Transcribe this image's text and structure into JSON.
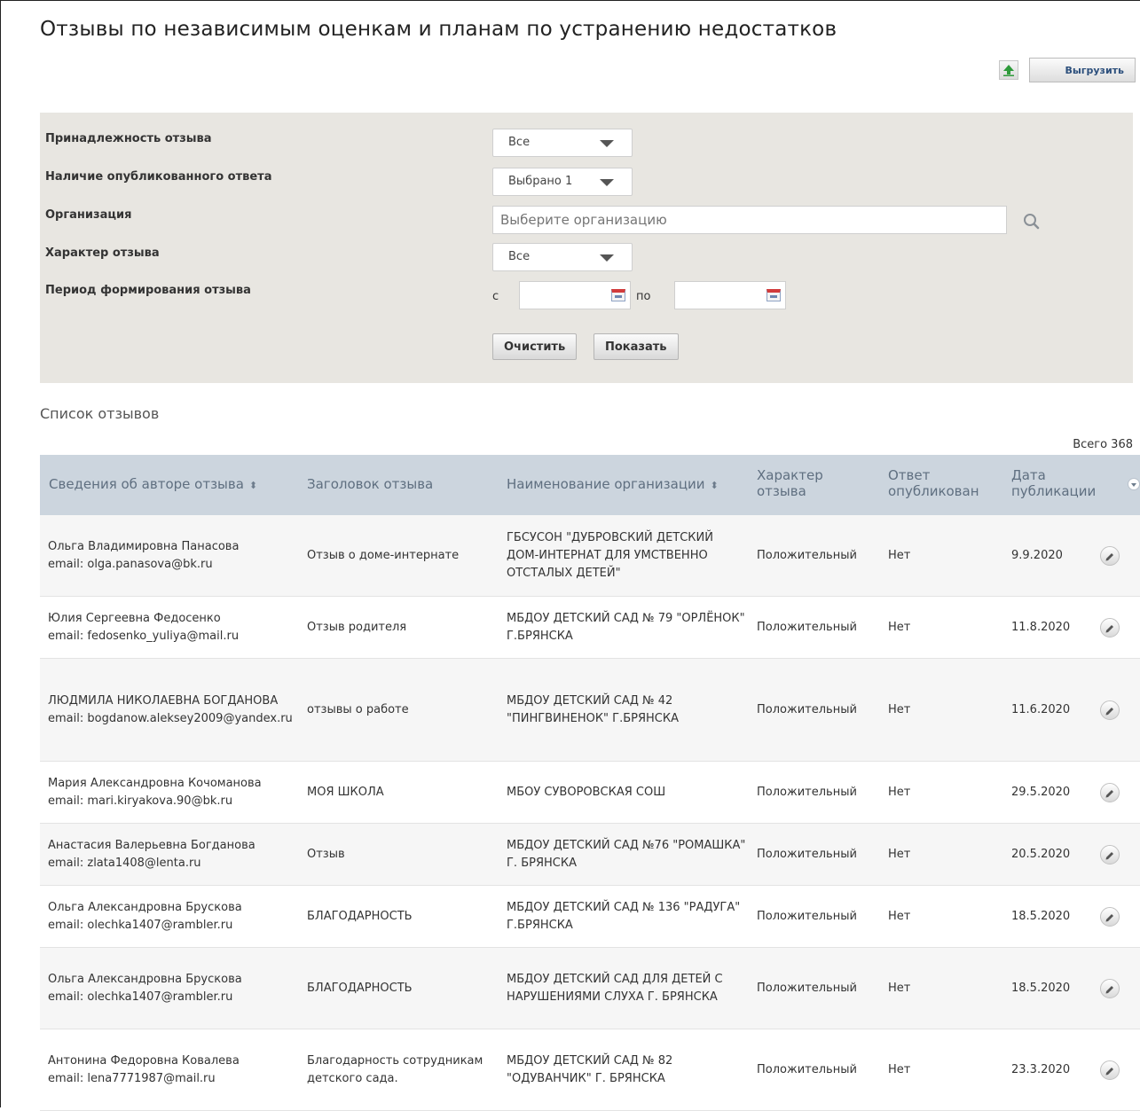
{
  "page": {
    "title": "Отзывы по независимым оценкам и планам по устранению недостатков",
    "export_label": "Выгрузить"
  },
  "filters": {
    "ownership": {
      "label": "Принадлежность отзыва",
      "value": "Все"
    },
    "published_answer": {
      "label": "Наличие опубликованного ответа",
      "value": "Выбрано 1"
    },
    "organization": {
      "label": "Организация",
      "placeholder": "Выберите организацию"
    },
    "character": {
      "label": "Характер отзыва",
      "value": "Все"
    },
    "period": {
      "label": "Период формирования отзыва",
      "from_label": "с",
      "to_label": "по",
      "from": "",
      "to": ""
    },
    "clear_label": "Очистить",
    "show_label": "Показать"
  },
  "list": {
    "title": "Список отзывов",
    "total": "Всего 368",
    "columns": [
      "Сведения об авторе отзыва",
      "Заголовок отзыва",
      "Наименование организации",
      "Характер отзыва",
      "Ответ опубликован",
      "Дата публикации"
    ],
    "rows": [
      {
        "author": "Ольга Владимировна Панасова",
        "email": "email: olga.panasova@bk.ru",
        "heading": "Отзыв о доме-интернате",
        "org": "ГБСУСОН \"ДУБРОВСКИЙ ДЕТСКИЙ ДОМ-ИНТЕРНАТ ДЛЯ УМСТВЕННО ОТСТАЛЫХ ДЕТЕЙ\"",
        "character": "Положительный",
        "answer": "Нет",
        "date": "9.9.2020"
      },
      {
        "author": "Юлия Сергеевна Федосенко",
        "email": "email: fedosenko_yuliya@mail.ru",
        "heading": "Отзыв родителя",
        "org": "МБДОУ ДЕТСКИЙ САД № 79 \"ОРЛЁНОК\" Г.БРЯНСКА",
        "character": "Положительный",
        "answer": "Нет",
        "date": "11.8.2020"
      },
      {
        "author": "ЛЮДМИЛА НИКОЛАЕВНА БОГДАНОВА",
        "email": "email: bogdanow.aleksey2009@yandex.ru",
        "heading": "отзывы о работе",
        "org": "МБДОУ ДЕТСКИЙ САД № 42 \"ПИНГВИНЕНОК\" Г.БРЯНСКА",
        "character": "Положительный",
        "answer": "Нет",
        "date": "11.6.2020"
      },
      {
        "author": "Мария Александровна Кочоманова",
        "email": "email: mari.kiryakova.90@bk.ru",
        "heading": "МОЯ ШКОЛА",
        "org": "МБОУ СУВОРОВСКАЯ СОШ",
        "character": "Положительный",
        "answer": "Нет",
        "date": "29.5.2020"
      },
      {
        "author": "Анастасия Валерьевна Богданова",
        "email": "email: zlata1408@lenta.ru",
        "heading": "Отзыв",
        "org": "МБДОУ ДЕТСКИЙ САД №76 \"РОМАШКА\" Г. БРЯНСКА",
        "character": "Положительный",
        "answer": "Нет",
        "date": "20.5.2020"
      },
      {
        "author": "Ольга Александровна Брускова",
        "email": "email: olechka1407@rambler.ru",
        "heading": "БЛАГОДАРНОСТЬ",
        "org": "МБДОУ ДЕТСКИЙ САД № 136 \"РАДУГА\" Г.БРЯНСКА",
        "character": "Положительный",
        "answer": "Нет",
        "date": "18.5.2020"
      },
      {
        "author": "Ольга Александровна Брускова",
        "email": "email: olechka1407@rambler.ru",
        "heading": "БЛАГОДАРНОСТЬ",
        "org": "МБДОУ ДЕТСКИЙ САД ДЛЯ ДЕТЕЙ С НАРУШЕНИЯМИ СЛУХА Г. БРЯНСКА",
        "character": "Положительный",
        "answer": "Нет",
        "date": "18.5.2020"
      },
      {
        "author": "Антонина Федоровна Ковалева",
        "email": "email: lena7771987@mail.ru",
        "heading": "Благодарность сотрудникам детского сада.",
        "org": "МБДОУ ДЕТСКИЙ САД № 82 \"ОДУВАНЧИК\" Г. БРЯНСКА",
        "character": "Положительный",
        "answer": "Нет",
        "date": "23.3.2020"
      }
    ]
  },
  "icons": {
    "export": "upload-arrow-icon",
    "search": "magnifier-icon",
    "calendar": "calendar-icon",
    "edit": "pencil-icon",
    "sort": "sort-arrows-icon",
    "column_menu": "chevron-down-icon"
  },
  "colors": {
    "filter_bg": "#e8e6e1",
    "header_bg": "#ccd5de",
    "export_arrow": "#2e9a3a"
  }
}
